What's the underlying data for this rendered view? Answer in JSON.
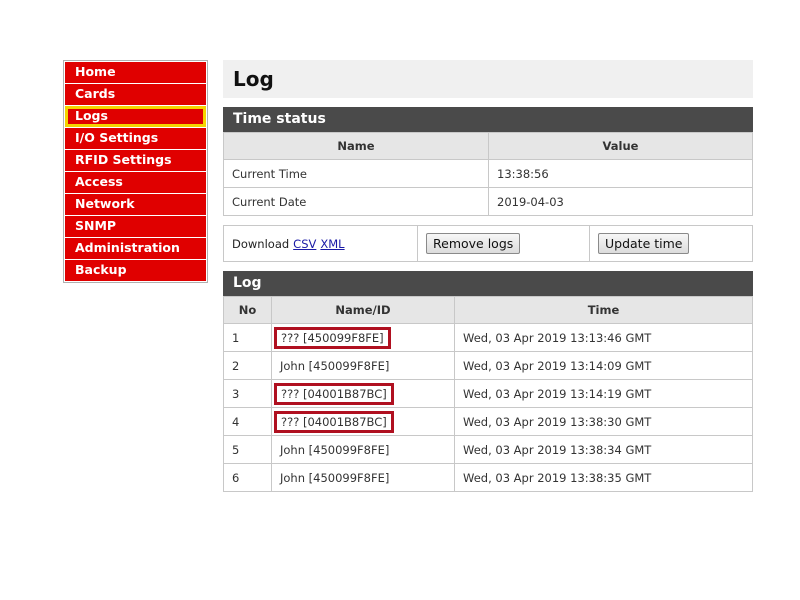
{
  "sidebar": {
    "items": [
      {
        "label": "Home"
      },
      {
        "label": "Cards"
      },
      {
        "label": "Logs"
      },
      {
        "label": "I/O Settings"
      },
      {
        "label": "RFID Settings"
      },
      {
        "label": "Access"
      },
      {
        "label": "Network"
      },
      {
        "label": "SNMP"
      },
      {
        "label": "Administration"
      },
      {
        "label": "Backup"
      }
    ],
    "active": "Logs"
  },
  "page": {
    "title": "Log"
  },
  "time_status": {
    "heading": "Time status",
    "columns": [
      "Name",
      "Value"
    ],
    "rows": [
      [
        "Current Time",
        "13:38:56"
      ],
      [
        "Current Date",
        "2019-04-03"
      ]
    ]
  },
  "actions": {
    "download_label": "Download",
    "csv_link": "CSV",
    "xml_link": "XML",
    "remove_logs": "Remove logs",
    "update_time": "Update time"
  },
  "log": {
    "heading": "Log",
    "columns": [
      "No",
      "Name/ID",
      "Time"
    ],
    "rows": [
      {
        "no": "1",
        "name": "??? [450099F8FE]",
        "time": "Wed, 03 Apr 2019 13:13:46 GMT"
      },
      {
        "no": "2",
        "name": "John [450099F8FE]",
        "time": "Wed, 03 Apr 2019 13:14:09 GMT"
      },
      {
        "no": "3",
        "name": "??? [04001B87BC]",
        "time": "Wed, 03 Apr 2019 13:14:19 GMT"
      },
      {
        "no": "4",
        "name": "??? [04001B87BC]",
        "time": "Wed, 03 Apr 2019 13:38:30 GMT"
      },
      {
        "no": "5",
        "name": "John [450099F8FE]",
        "time": "Wed, 03 Apr 2019 13:38:34 GMT"
      },
      {
        "no": "6",
        "name": "John [450099F8FE]",
        "time": "Wed, 03 Apr 2019 13:38:35 GMT"
      }
    ]
  },
  "colors": {
    "sidebar_item": "#e00000",
    "active_outline": "#f5d400",
    "highlight_box": "#b01020",
    "section_header": "#4a4a4a"
  }
}
